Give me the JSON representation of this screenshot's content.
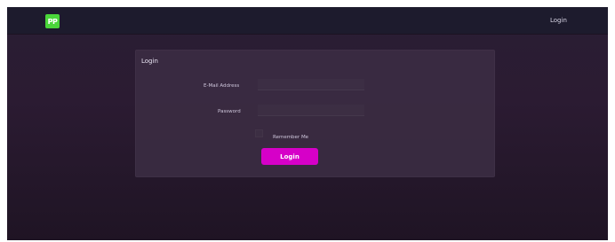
{
  "navbar": {
    "logo_text": "PP",
    "login_link": "Login"
  },
  "login_card": {
    "title": "Login",
    "email_label": "E-Mail Address",
    "password_label": "Password",
    "remember_label": "Remember Me",
    "submit_label": "Login"
  },
  "colors": {
    "logo_green": "#4ad63a",
    "button_magenta": "#d600c8",
    "navbar_bg": "#1d1b2d",
    "page_bg": "#2a1e34"
  }
}
